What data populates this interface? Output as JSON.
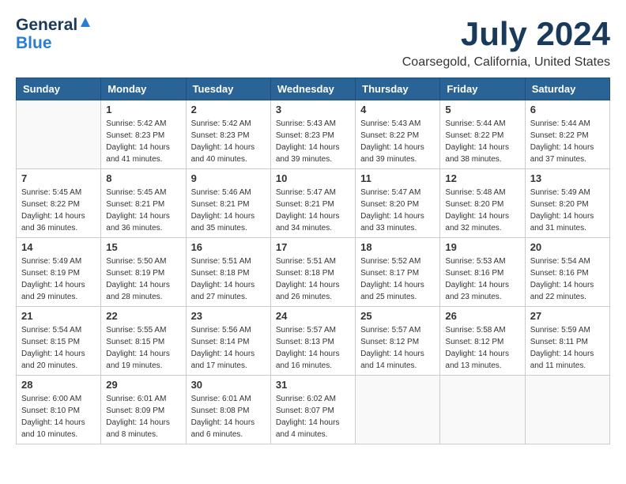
{
  "header": {
    "logo_general": "General",
    "logo_blue": "Blue",
    "month_year": "July 2024",
    "location": "Coarsegold, California, United States"
  },
  "calendar": {
    "days_of_week": [
      "Sunday",
      "Monday",
      "Tuesday",
      "Wednesday",
      "Thursday",
      "Friday",
      "Saturday"
    ],
    "weeks": [
      [
        {
          "day": "",
          "sunrise": "",
          "sunset": "",
          "daylight": ""
        },
        {
          "day": "1",
          "sunrise": "Sunrise: 5:42 AM",
          "sunset": "Sunset: 8:23 PM",
          "daylight": "Daylight: 14 hours and 41 minutes."
        },
        {
          "day": "2",
          "sunrise": "Sunrise: 5:42 AM",
          "sunset": "Sunset: 8:23 PM",
          "daylight": "Daylight: 14 hours and 40 minutes."
        },
        {
          "day": "3",
          "sunrise": "Sunrise: 5:43 AM",
          "sunset": "Sunset: 8:23 PM",
          "daylight": "Daylight: 14 hours and 39 minutes."
        },
        {
          "day": "4",
          "sunrise": "Sunrise: 5:43 AM",
          "sunset": "Sunset: 8:22 PM",
          "daylight": "Daylight: 14 hours and 39 minutes."
        },
        {
          "day": "5",
          "sunrise": "Sunrise: 5:44 AM",
          "sunset": "Sunset: 8:22 PM",
          "daylight": "Daylight: 14 hours and 38 minutes."
        },
        {
          "day": "6",
          "sunrise": "Sunrise: 5:44 AM",
          "sunset": "Sunset: 8:22 PM",
          "daylight": "Daylight: 14 hours and 37 minutes."
        }
      ],
      [
        {
          "day": "7",
          "sunrise": "Sunrise: 5:45 AM",
          "sunset": "Sunset: 8:22 PM",
          "daylight": "Daylight: 14 hours and 36 minutes."
        },
        {
          "day": "8",
          "sunrise": "Sunrise: 5:45 AM",
          "sunset": "Sunset: 8:21 PM",
          "daylight": "Daylight: 14 hours and 36 minutes."
        },
        {
          "day": "9",
          "sunrise": "Sunrise: 5:46 AM",
          "sunset": "Sunset: 8:21 PM",
          "daylight": "Daylight: 14 hours and 35 minutes."
        },
        {
          "day": "10",
          "sunrise": "Sunrise: 5:47 AM",
          "sunset": "Sunset: 8:21 PM",
          "daylight": "Daylight: 14 hours and 34 minutes."
        },
        {
          "day": "11",
          "sunrise": "Sunrise: 5:47 AM",
          "sunset": "Sunset: 8:20 PM",
          "daylight": "Daylight: 14 hours and 33 minutes."
        },
        {
          "day": "12",
          "sunrise": "Sunrise: 5:48 AM",
          "sunset": "Sunset: 8:20 PM",
          "daylight": "Daylight: 14 hours and 32 minutes."
        },
        {
          "day": "13",
          "sunrise": "Sunrise: 5:49 AM",
          "sunset": "Sunset: 8:20 PM",
          "daylight": "Daylight: 14 hours and 31 minutes."
        }
      ],
      [
        {
          "day": "14",
          "sunrise": "Sunrise: 5:49 AM",
          "sunset": "Sunset: 8:19 PM",
          "daylight": "Daylight: 14 hours and 29 minutes."
        },
        {
          "day": "15",
          "sunrise": "Sunrise: 5:50 AM",
          "sunset": "Sunset: 8:19 PM",
          "daylight": "Daylight: 14 hours and 28 minutes."
        },
        {
          "day": "16",
          "sunrise": "Sunrise: 5:51 AM",
          "sunset": "Sunset: 8:18 PM",
          "daylight": "Daylight: 14 hours and 27 minutes."
        },
        {
          "day": "17",
          "sunrise": "Sunrise: 5:51 AM",
          "sunset": "Sunset: 8:18 PM",
          "daylight": "Daylight: 14 hours and 26 minutes."
        },
        {
          "day": "18",
          "sunrise": "Sunrise: 5:52 AM",
          "sunset": "Sunset: 8:17 PM",
          "daylight": "Daylight: 14 hours and 25 minutes."
        },
        {
          "day": "19",
          "sunrise": "Sunrise: 5:53 AM",
          "sunset": "Sunset: 8:16 PM",
          "daylight": "Daylight: 14 hours and 23 minutes."
        },
        {
          "day": "20",
          "sunrise": "Sunrise: 5:54 AM",
          "sunset": "Sunset: 8:16 PM",
          "daylight": "Daylight: 14 hours and 22 minutes."
        }
      ],
      [
        {
          "day": "21",
          "sunrise": "Sunrise: 5:54 AM",
          "sunset": "Sunset: 8:15 PM",
          "daylight": "Daylight: 14 hours and 20 minutes."
        },
        {
          "day": "22",
          "sunrise": "Sunrise: 5:55 AM",
          "sunset": "Sunset: 8:15 PM",
          "daylight": "Daylight: 14 hours and 19 minutes."
        },
        {
          "day": "23",
          "sunrise": "Sunrise: 5:56 AM",
          "sunset": "Sunset: 8:14 PM",
          "daylight": "Daylight: 14 hours and 17 minutes."
        },
        {
          "day": "24",
          "sunrise": "Sunrise: 5:57 AM",
          "sunset": "Sunset: 8:13 PM",
          "daylight": "Daylight: 14 hours and 16 minutes."
        },
        {
          "day": "25",
          "sunrise": "Sunrise: 5:57 AM",
          "sunset": "Sunset: 8:12 PM",
          "daylight": "Daylight: 14 hours and 14 minutes."
        },
        {
          "day": "26",
          "sunrise": "Sunrise: 5:58 AM",
          "sunset": "Sunset: 8:12 PM",
          "daylight": "Daylight: 14 hours and 13 minutes."
        },
        {
          "day": "27",
          "sunrise": "Sunrise: 5:59 AM",
          "sunset": "Sunset: 8:11 PM",
          "daylight": "Daylight: 14 hours and 11 minutes."
        }
      ],
      [
        {
          "day": "28",
          "sunrise": "Sunrise: 6:00 AM",
          "sunset": "Sunset: 8:10 PM",
          "daylight": "Daylight: 14 hours and 10 minutes."
        },
        {
          "day": "29",
          "sunrise": "Sunrise: 6:01 AM",
          "sunset": "Sunset: 8:09 PM",
          "daylight": "Daylight: 14 hours and 8 minutes."
        },
        {
          "day": "30",
          "sunrise": "Sunrise: 6:01 AM",
          "sunset": "Sunset: 8:08 PM",
          "daylight": "Daylight: 14 hours and 6 minutes."
        },
        {
          "day": "31",
          "sunrise": "Sunrise: 6:02 AM",
          "sunset": "Sunset: 8:07 PM",
          "daylight": "Daylight: 14 hours and 4 minutes."
        },
        {
          "day": "",
          "sunrise": "",
          "sunset": "",
          "daylight": ""
        },
        {
          "day": "",
          "sunrise": "",
          "sunset": "",
          "daylight": ""
        },
        {
          "day": "",
          "sunrise": "",
          "sunset": "",
          "daylight": ""
        }
      ]
    ]
  }
}
